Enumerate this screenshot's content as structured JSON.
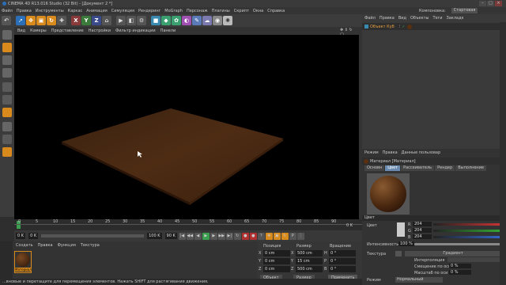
{
  "window": {
    "title": "CINEMA 4D R13.016 Studio (32 Bit) - [Документ 2 *]"
  },
  "menubar": {
    "items": [
      "Файл",
      "Правка",
      "Инструменты",
      "Каркас",
      "Анимация",
      "Симуляция",
      "Рендеринг",
      "MoGraph",
      "Персонаж",
      "Плагины",
      "Скрипт",
      "Окна",
      "Справка"
    ],
    "layout_label": "Компоновка:",
    "layout_value": "Стартовая"
  },
  "toolbar": {
    "axis_x": "X",
    "axis_y": "Y",
    "axis_z": "Z"
  },
  "viewport": {
    "menu": [
      "Вид",
      "Камеры",
      "Представление",
      "Настройки",
      "Фильтр индикации",
      "Панели"
    ]
  },
  "timeline": {
    "ticks": [
      "0",
      "5",
      "10",
      "15",
      "20",
      "25",
      "30",
      "35",
      "40",
      "45",
      "50",
      "55",
      "60",
      "65",
      "70",
      "75",
      "80",
      "85",
      "90"
    ],
    "end_frame": "0 K"
  },
  "playbar": {
    "start": "0 K",
    "min": "0 K",
    "max": "100 K",
    "end": "90 K"
  },
  "material_manager": {
    "menu": [
      "Создать",
      "Правка",
      "Функция",
      "Текстура"
    ],
    "material_name": "Материал"
  },
  "coordinates": {
    "headers": [
      "Позиция",
      "Размер",
      "Вращение"
    ],
    "rows": [
      {
        "axis": "X",
        "pos": "0 cm",
        "size": "500 cm",
        "rot_axis": "H",
        "rot": "0 °"
      },
      {
        "axis": "Y",
        "pos": "0 cm",
        "size": "15 cm",
        "rot_axis": "P",
        "rot": "0 °"
      },
      {
        "axis": "Z",
        "pos": "0 cm",
        "size": "500 cm",
        "rot_axis": "B",
        "rot": "0 °"
      }
    ],
    "mode": "Объект",
    "size_mode": "Размер",
    "apply": "Применить"
  },
  "object_manager": {
    "menu": [
      "Файл",
      "Правка",
      "Вид",
      "Объекты",
      "Теги",
      "Закладк"
    ],
    "object_name": "Объект Куб"
  },
  "attribute_manager": {
    "menu": [
      "Режим",
      "Правка",
      "Данные пользовар"
    ],
    "title": "Материал [Материал]",
    "tabs": [
      "Основн",
      "Цвет",
      "Рассеиватель",
      "Рендер",
      "Выполнение"
    ],
    "active_tab": "Цвет",
    "section": "Цвет",
    "color_label": "Цвет",
    "r": "204",
    "g": "204",
    "b": "204",
    "brightness_label": "Интенсивность",
    "brightness_value": "100 %",
    "texture_label": "Текстура",
    "texture_value": "Градиент",
    "interp_label": "Интерполяция",
    "offset_label": "Смещение по оси",
    "offset_value": "0 %",
    "scale_label": "Масштаб по оси",
    "scale_value": "0 %",
    "mode_label": "Режим",
    "mode_value": "Нормальный"
  },
  "statusbar": {
    "text": "...вновые и перетащите для перемещения элементов. Нажать SHIFT для растягивания движения."
  },
  "colors": {
    "accent": "#6a8ab0",
    "floor": "#4a2a14",
    "orange": "#d88a1c"
  }
}
